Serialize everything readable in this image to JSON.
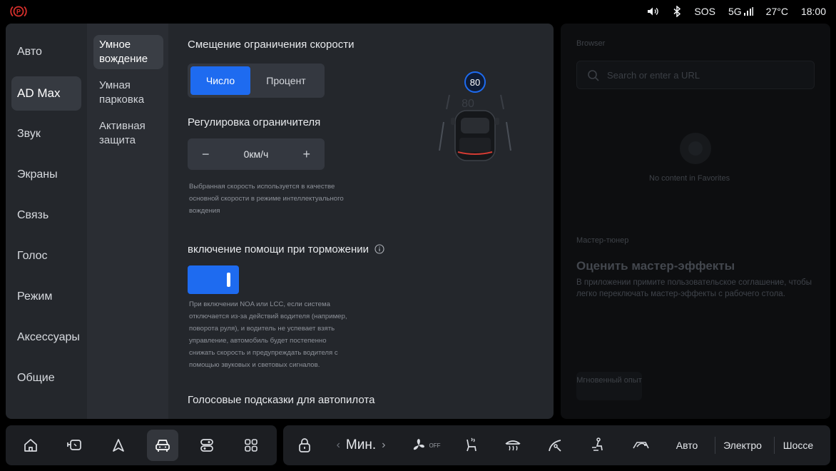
{
  "status_bar": {
    "left_icon": "parking-brake-icon",
    "volume_icon": "speaker-icon",
    "bluetooth_icon": "bluetooth-icon",
    "sos": "SOS",
    "network": "5G",
    "temperature": "27°C",
    "time": "18:00",
    "alert_color": "#d9302c"
  },
  "nav_primary": {
    "items": [
      "Авто",
      "AD Max",
      "Звук",
      "Экраны",
      "Связь",
      "Голос",
      "Режим",
      "Аксессуары",
      "Общие"
    ],
    "active": "AD Max"
  },
  "nav_secondary": {
    "items": [
      "Умное вождение",
      "Умная парковка",
      "Активная защита"
    ],
    "active": "Умное вождение"
  },
  "content": {
    "speed_offset": {
      "title": "Смещение ограничения скорости",
      "options": [
        "Число",
        "Процент"
      ],
      "selected": "Число"
    },
    "limiter": {
      "title": "Регулировка ограничителя",
      "minus": "−",
      "value": "0км/ч",
      "plus": "+",
      "hint_lines": [
        "Выбранная скорость используется в качестве",
        "основной скорости в режиме интеллектуального",
        "вождения"
      ]
    },
    "brake_assist": {
      "title": "включение помощи при торможении",
      "enabled": true,
      "hint_lines": [
        "При включении NOA или LCC, если система",
        "отключается из-за действий водителя (например,",
        "поворота руля), и водитель не успевает взять",
        "управление, автомобиль будет постепенно",
        "снижать скорость и предупреждать водителя с",
        "помощью звуковых и световых сигналов."
      ]
    },
    "voice_hints": {
      "title": "Голосовые подсказки для автопилота"
    },
    "car_visual": {
      "speed_limit_sign": "80",
      "faded_value": "80"
    }
  },
  "browser": {
    "title": "Browser",
    "search_placeholder": "Search or enter a URL",
    "empty_text": "No content in Favorites",
    "tuner_label": "Мастер-тюнер",
    "tuner_title": "Оценить мастер-эффекты",
    "tuner_desc": "В приложении примите пользовательское соглашение, чтобы легко переключать мастер-эффекты с рабочего стола.",
    "instant_button": "Мгновенный опыт"
  },
  "dock": {
    "apps": [
      "home-icon",
      "mirror-icon",
      "navigation-icon",
      "car-icon",
      "controls-icon",
      "apps-grid-icon"
    ],
    "active_app": "car-icon",
    "lock_icon": "lock-icon",
    "fan_speed_prev": "‹",
    "fan_speed": "Мин.",
    "fan_speed_next": "›",
    "fan_state": "OFF",
    "modes": [
      "Авто",
      "Электро",
      "Шоссе"
    ],
    "accent": "#1e6bf0"
  }
}
